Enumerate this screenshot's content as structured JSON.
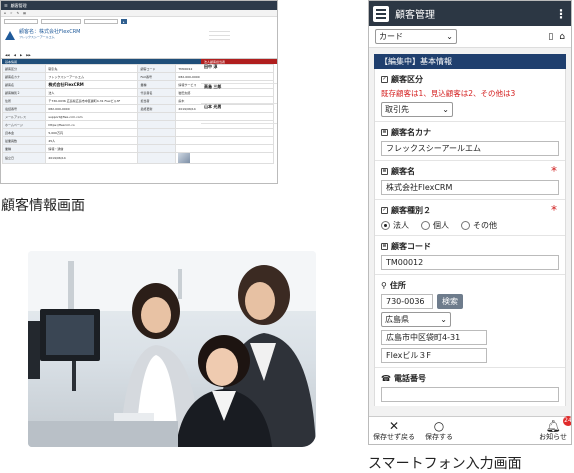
{
  "captions": {
    "desktop": "顧客情報画面",
    "phone": "スマートフォン入力画面"
  },
  "desktop": {
    "title": "顧客管理",
    "company_name": "顧客名：株式会社FlexCRM",
    "kana": "フレックスシーアールエム",
    "row_labels": [
      "顧客区分",
      "顧客名カナ",
      "顧客名",
      "顧客種別２",
      "住所",
      "電話番号",
      "メールアドレス",
      "ホームページ",
      "資本金",
      "従業員数",
      "業種",
      "設立日"
    ],
    "row_values": [
      "取引先",
      "フレックスシーアールエム",
      "株式会社FlexCRM",
      "法人",
      "〒730-0036 広島県広島市中区袋町4-31 Flexビル3F",
      "082-000-0000",
      "support@flex-crm.com",
      "https://flexcrm.co",
      "5,000万円",
      "45人",
      "情報・通信",
      "2019/06/14"
    ],
    "right_labels": [
      "顧客コード",
      "FAX番号",
      "業種",
      "代表者名",
      "担当者",
      "最終更新"
    ],
    "right_values": [
      "TM00012",
      "082-000-0000",
      "情報サービス",
      "岩田太郎",
      "鈴木",
      "2019/06/14"
    ],
    "contacts_header": "法人顧客担当者",
    "contacts": [
      "田中 淳",
      "高島 三郎",
      "山本 光男"
    ],
    "section_header": "基本情報"
  },
  "phone": {
    "title": "顧客管理",
    "view_select": "カード",
    "section_header": "【編集中】基本情報",
    "fields": {
      "category_label": "顧客区分",
      "category_note": "既存顧客は1、見込顧客は2、その他は3",
      "category_value": "取引先",
      "kana_label": "顧客名カナ",
      "kana_value": "フレックスシーアールエム",
      "name_label": "顧客名",
      "name_value": "株式会社FlexCRM",
      "type_label": "顧客種別２",
      "type_options": [
        "法人",
        "個人",
        "その他"
      ],
      "code_label": "顧客コード",
      "code_value": "TM00012",
      "address_label": "住所",
      "zip_value": "730-0036",
      "search_button": "検索",
      "pref_value": "広島県",
      "address1_value": "広島市中区袋町4-31",
      "address2_value": "Flexビル３F",
      "phone_label": "電話番号"
    },
    "bottom": {
      "cancel": "保存せず戻る",
      "save": "保存する",
      "notify": "お知らせ",
      "notify_count": "24"
    }
  }
}
